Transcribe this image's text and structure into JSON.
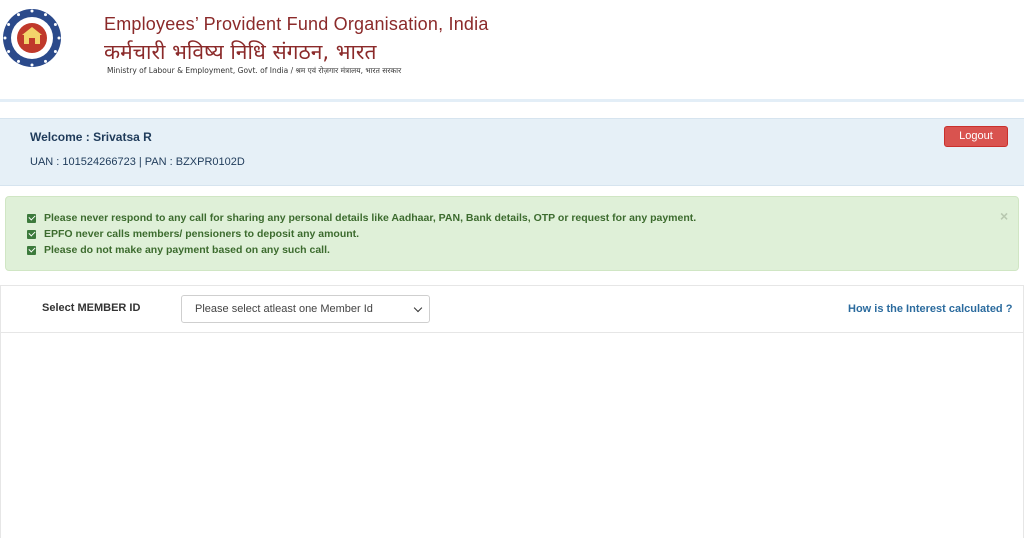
{
  "header": {
    "org_name_en": "Employees’ Provident Fund Organisation, India",
    "org_name_hi": "कर्मचारी भविष्य निधि संगठन, भारत",
    "ministry": "Ministry of Labour & Employment, Govt. of India / श्रम एवं रोज़गार मंत्रालय, भारत सरकार",
    "logo_icon": "epfo-emblem-icon"
  },
  "welcome": {
    "greeting": "Welcome : Srivatsa R",
    "uan_pan": "UAN : 101524266723 | PAN : BZXPR0102D",
    "logout_label": "Logout"
  },
  "alert": {
    "items": [
      "Please never respond to any call for sharing any personal details like Aadhaar, PAN, Bank details, OTP or request for any payment.",
      "EPFO never calls members/ pensioners to deposit any amount.",
      "Please do not make any payment based on any such call."
    ],
    "close_glyph": "×"
  },
  "member": {
    "label": "Select MEMBER ID",
    "select_value": "Please select atleast one Member Id",
    "interest_link": "How is the Interest calculated ?"
  },
  "colors": {
    "brand": "#8b2a2a",
    "logout": "#d9534f",
    "alert_bg": "#dff0d8",
    "alert_text": "#3c6b2e",
    "welcome_bg": "#e6f0f7",
    "link": "#2b6b9e"
  }
}
